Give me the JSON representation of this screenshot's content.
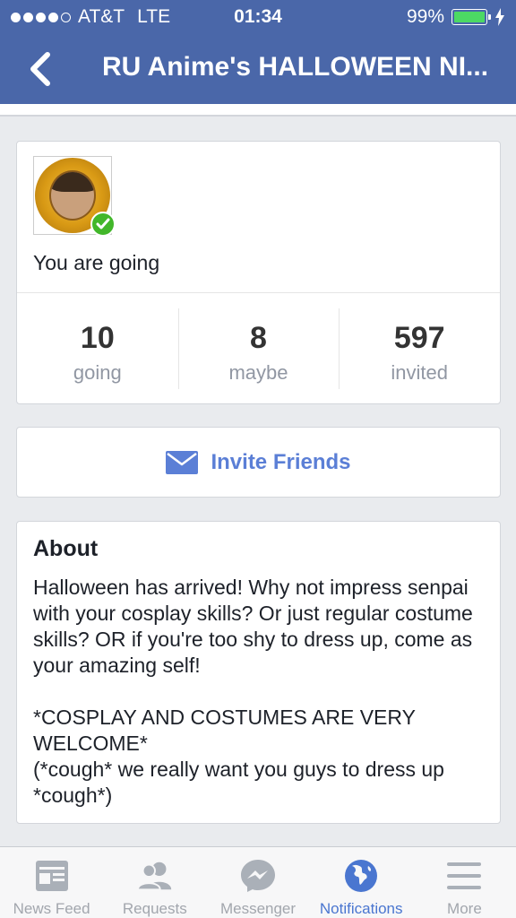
{
  "status_bar": {
    "carrier": "AT&T",
    "network": "LTE",
    "time": "01:34",
    "battery": "99%",
    "battery_level": 0.99,
    "signal_bars": 4
  },
  "nav": {
    "title": "RU Anime's HALLOWEEN NI...",
    "back_icon": "chevron-left-icon"
  },
  "rsvp": {
    "status_text": "You are going",
    "stats": [
      {
        "value": "10",
        "label": "going"
      },
      {
        "value": "8",
        "label": "maybe"
      },
      {
        "value": "597",
        "label": "invited"
      }
    ]
  },
  "invite": {
    "label": "Invite Friends",
    "icon": "envelope-icon"
  },
  "about": {
    "title": "About",
    "body": "Halloween has arrived! Why not impress senpai with your cosplay skills? Or just regular costume skills? OR if you're too shy to dress up, come as your amazing self!\n\n*COSPLAY AND COSTUMES ARE VERY WELCOME*\n(*cough* we really want you guys to dress up *cough*)"
  },
  "tabbar": {
    "items": [
      {
        "label": "News Feed",
        "icon": "news-feed-icon",
        "active": false
      },
      {
        "label": "Requests",
        "icon": "friends-icon",
        "active": false
      },
      {
        "label": "Messenger",
        "icon": "messenger-icon",
        "active": false
      },
      {
        "label": "Notifications",
        "icon": "globe-icon",
        "active": true
      },
      {
        "label": "More",
        "icon": "menu-icon",
        "active": false
      }
    ]
  },
  "colors": {
    "header_bg": "#4a67a9",
    "accent": "#5b7fd6",
    "active_tab": "#4a76d0",
    "check_green": "#42b72a"
  }
}
